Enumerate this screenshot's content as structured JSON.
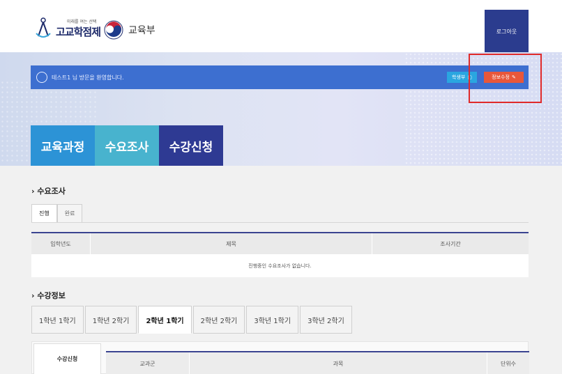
{
  "header": {
    "logo_sub": "미래를 여는 선택",
    "logo_main": "고교학점제",
    "ministry": "교육부",
    "logout_label": "로그아웃"
  },
  "welcome": {
    "message": "테스트1 님 방문을 환영합니다.",
    "portfolio_label": "학생부",
    "edit_label": "정보수정"
  },
  "menu": [
    "교육과정",
    "수요조사",
    "수강신청"
  ],
  "survey": {
    "title": "수요조사",
    "tabs": [
      "진행",
      "완료"
    ],
    "columns": [
      "입학년도",
      "제목",
      "조사기간"
    ],
    "empty_message": "진행중인 수요조사가 없습니다."
  },
  "course_info": {
    "title": "수강정보",
    "terms": [
      "1학년 1학기",
      "1학년 2학기",
      "2학년 1학기",
      "2학년 2학기",
      "3학년 1학기",
      "3학년 2학기"
    ],
    "active_term_index": 2,
    "side_label": "수강신청",
    "columns": [
      "교과군",
      "과목",
      "단위수"
    ]
  },
  "colors": {
    "navy": "#2e3a93",
    "blue": "#3d6fd0",
    "edit_orange": "#e8573a",
    "highlight_red": "#e02a2a"
  }
}
